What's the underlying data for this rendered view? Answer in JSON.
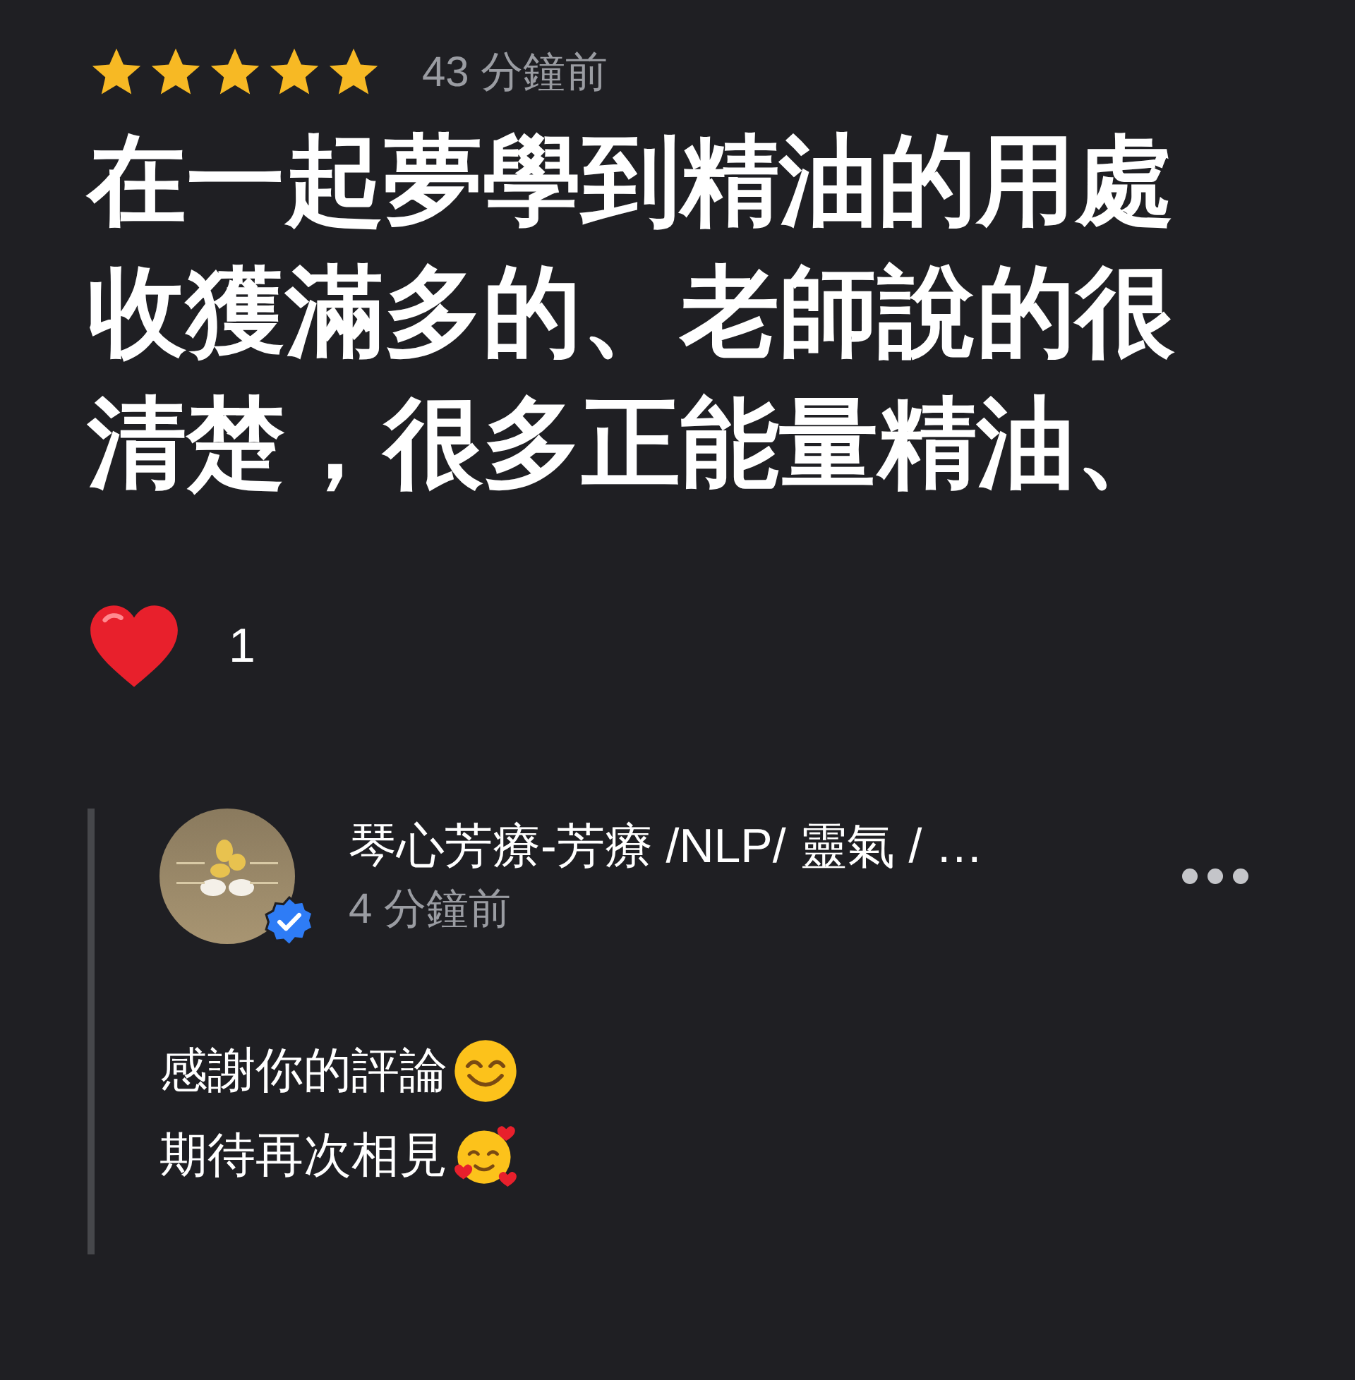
{
  "review": {
    "stars": 5,
    "time": "43 分鐘前",
    "text": "在一起夢學到精油的用處收獲滿多的、老師說的很清楚，很多正能量精油、"
  },
  "reactions": {
    "count": "1"
  },
  "reply": {
    "author": "琴心芳療-芳療 /NLP/ 靈氣 / …",
    "verified": true,
    "time": "4 分鐘前",
    "lines": [
      {
        "text": "感謝你的評論",
        "kind": "smile"
      },
      {
        "text": "期待再次相見",
        "kind": "hearts"
      }
    ]
  }
}
